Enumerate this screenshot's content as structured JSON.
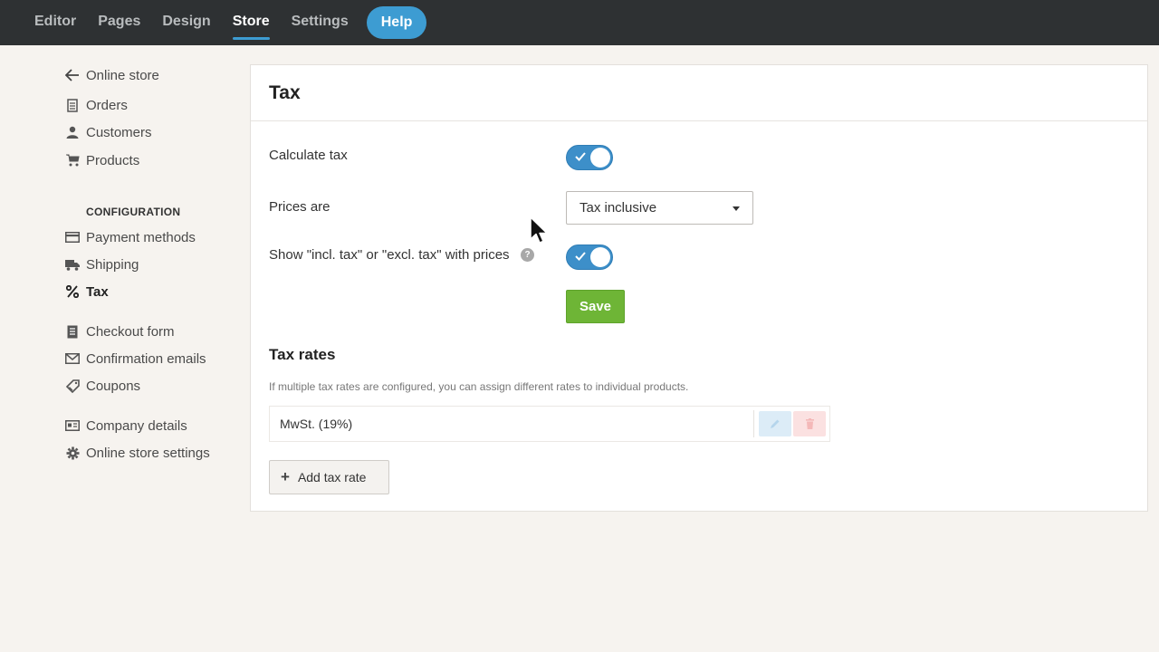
{
  "topnav": {
    "items": [
      {
        "label": "Editor"
      },
      {
        "label": "Pages"
      },
      {
        "label": "Design"
      },
      {
        "label": "Store",
        "active": true
      },
      {
        "label": "Settings"
      }
    ],
    "help_label": "Help"
  },
  "sidebar": {
    "back_label": "Online store",
    "group1": [
      {
        "label": "Orders",
        "icon": "receipt-icon"
      },
      {
        "label": "Customers",
        "icon": "person-icon"
      },
      {
        "label": "Products",
        "icon": "cart-icon"
      }
    ],
    "config_heading": "CONFIGURATION",
    "group2": [
      {
        "label": "Payment methods",
        "icon": "credit-card-icon"
      },
      {
        "label": "Shipping",
        "icon": "truck-icon"
      },
      {
        "label": "Tax",
        "icon": "percent-icon",
        "active": true
      }
    ],
    "group3": [
      {
        "label": "Checkout form",
        "icon": "form-icon"
      },
      {
        "label": "Confirmation emails",
        "icon": "envelope-icon"
      },
      {
        "label": "Coupons",
        "icon": "tag-icon"
      }
    ],
    "group4": [
      {
        "label": "Company details",
        "icon": "id-card-icon"
      },
      {
        "label": "Online store settings",
        "icon": "gear-icon"
      }
    ]
  },
  "panel": {
    "title": "Tax",
    "calculate_tax_label": "Calculate tax",
    "calculate_tax_on": true,
    "prices_are_label": "Prices are",
    "prices_are_value": "Tax inclusive",
    "show_incl_label": "Show \"incl. tax\" or \"excl. tax\" with prices",
    "show_incl_on": true,
    "help_glyph": "?",
    "save_label": "Save",
    "tax_rates_title": "Tax rates",
    "tax_rates_desc": "If multiple tax rates are configured, you can assign different rates to individual products.",
    "rates": [
      {
        "name": "MwSt. (19%)"
      }
    ],
    "add_rate_label": "Add tax rate",
    "add_rate_glyph": "+"
  },
  "colors": {
    "topbar": "#2e3133",
    "accent_blue": "#3d9cd2",
    "toggle_blue": "#3d8fc9",
    "save_green": "#6eb536",
    "background": "#f6f3ef"
  }
}
